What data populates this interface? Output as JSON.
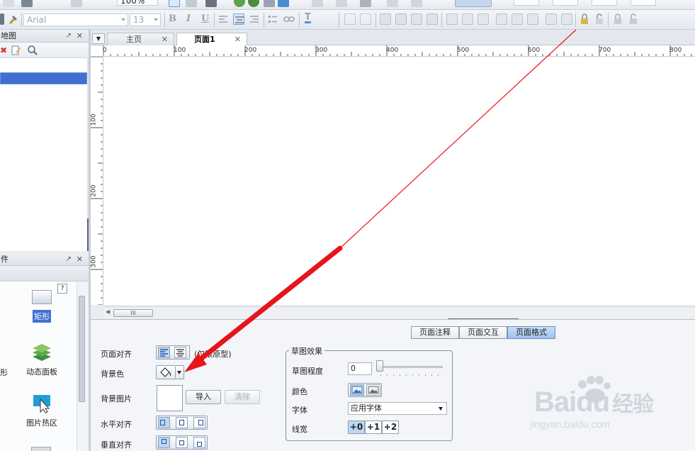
{
  "toolbar": {
    "zoom_value": "100%",
    "font_name": "Arial",
    "font_size": "13",
    "bold": "B",
    "italic": "I",
    "underline": "U",
    "text_color": "T"
  },
  "sitemap_panel": {
    "title": "地图",
    "pin": "↗",
    "close": "✕"
  },
  "widgets_panel": {
    "title": "件",
    "pin": "↗",
    "close": "✕",
    "help": "?",
    "items": [
      {
        "label": "矩形",
        "icon": "rectangle-icon"
      },
      {
        "label": "动态面板",
        "icon": "layers-icon"
      },
      {
        "label": "形",
        "icon": "shape-icon"
      },
      {
        "label": "图片热区",
        "icon": "hotspot-icon"
      }
    ]
  },
  "tabs": [
    {
      "label": "主页",
      "close": "✕"
    },
    {
      "label": "页面1",
      "close": "✕",
      "active": true
    }
  ],
  "rulers": {
    "horizontal": [
      "0",
      "100",
      "200",
      "300",
      "400",
      "500",
      "600",
      "700",
      "800"
    ],
    "vertical": [
      "100",
      "200",
      "300"
    ]
  },
  "hscroll_grip": "III",
  "property_tabs": [
    {
      "label": "页面注释"
    },
    {
      "label": "页面交互"
    },
    {
      "label": "页面格式",
      "active": true
    }
  ],
  "page_format": {
    "align_label": "页面对齐",
    "align_note": "(仅限原型)",
    "bg_color_label": "背景色",
    "bg_image_label": "背景图片",
    "import_button": "导入",
    "clear_button": "清除",
    "h_align_label": "水平对齐",
    "v_align_label": "垂直对齐"
  },
  "sketch": {
    "group_title": "草图效果",
    "level_label": "草图程度",
    "level_value": "0",
    "color_label": "颜色",
    "font_label": "字体",
    "font_value": "应用字体",
    "linewidth_label": "线宽",
    "linewidths": [
      "+0",
      "+1",
      "+2"
    ]
  },
  "watermark": {
    "brand": "Baidu",
    "cn": "经验",
    "url": "jingyan.baidu.com"
  },
  "colors": {
    "selection": "#3f6fd1",
    "annotation_arrow": "#e8141a",
    "active_tab": "#bcd6f3"
  }
}
